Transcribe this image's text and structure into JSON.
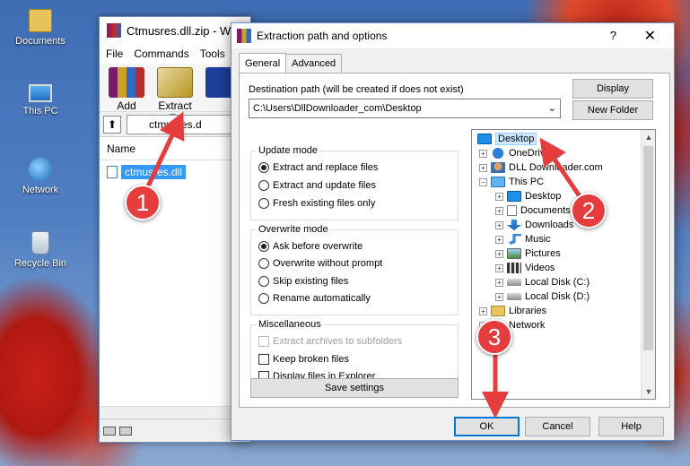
{
  "desktop": {
    "icons": [
      {
        "label": "Documents"
      },
      {
        "label": "This PC"
      },
      {
        "label": "Network"
      },
      {
        "label": "Recycle Bin"
      }
    ]
  },
  "winrar": {
    "title": "Ctmusres.dll.zip - W",
    "menu": [
      "File",
      "Commands",
      "Tools"
    ],
    "toolbar": {
      "add": "Add",
      "extract_to": "Extract To"
    },
    "address": "ctmusres.d",
    "column_name": "Name",
    "file": "ctmusres.dll"
  },
  "dialog": {
    "title": "Extraction path and options",
    "help_glyph": "?",
    "close_glyph": "✕",
    "tabs": [
      "General",
      "Advanced"
    ],
    "destination_label": "Destination path (will be created if does not exist)",
    "destination_value": "C:\\Users\\DllDownloader_com\\Desktop",
    "display_button": "Display",
    "new_folder_button": "New Folder",
    "update_mode": {
      "title": "Update mode",
      "options": [
        "Extract and replace files",
        "Extract and update files",
        "Fresh existing files only"
      ],
      "selected": 0
    },
    "overwrite_mode": {
      "title": "Overwrite mode",
      "options": [
        "Ask before overwrite",
        "Overwrite without prompt",
        "Skip existing files",
        "Rename automatically"
      ],
      "selected": 0
    },
    "misc": {
      "title": "Miscellaneous",
      "options": [
        "Extract archives to subfolders",
        "Keep broken files",
        "Display files in Explorer"
      ]
    },
    "save_settings": "Save settings",
    "tree": [
      {
        "label": "Desktop",
        "icon": "desktop-icon"
      },
      {
        "label": "OneDrive",
        "icon": "onedrive-icon"
      },
      {
        "label": "DLL Downloader.com",
        "icon": "user-icon"
      },
      {
        "label": "This PC",
        "icon": "pc-icon"
      },
      {
        "label": "Desktop",
        "icon": "desktop-icon"
      },
      {
        "label": "Documents",
        "icon": "documents-icon"
      },
      {
        "label": "Downloads",
        "icon": "downloads-icon"
      },
      {
        "label": "Music",
        "icon": "music-icon"
      },
      {
        "label": "Pictures",
        "icon": "pictures-icon"
      },
      {
        "label": "Videos",
        "icon": "videos-icon"
      },
      {
        "label": "Local Disk (C:)",
        "icon": "disk-icon"
      },
      {
        "label": "Local Disk (D:)",
        "icon": "disk-icon"
      },
      {
        "label": "Libraries",
        "icon": "libraries-icon"
      },
      {
        "label": "Network",
        "icon": "network-icon"
      }
    ],
    "ok": "OK",
    "cancel": "Cancel",
    "help": "Help"
  },
  "markers": [
    "1",
    "2",
    "3"
  ],
  "accent_color": "#e53d3d"
}
